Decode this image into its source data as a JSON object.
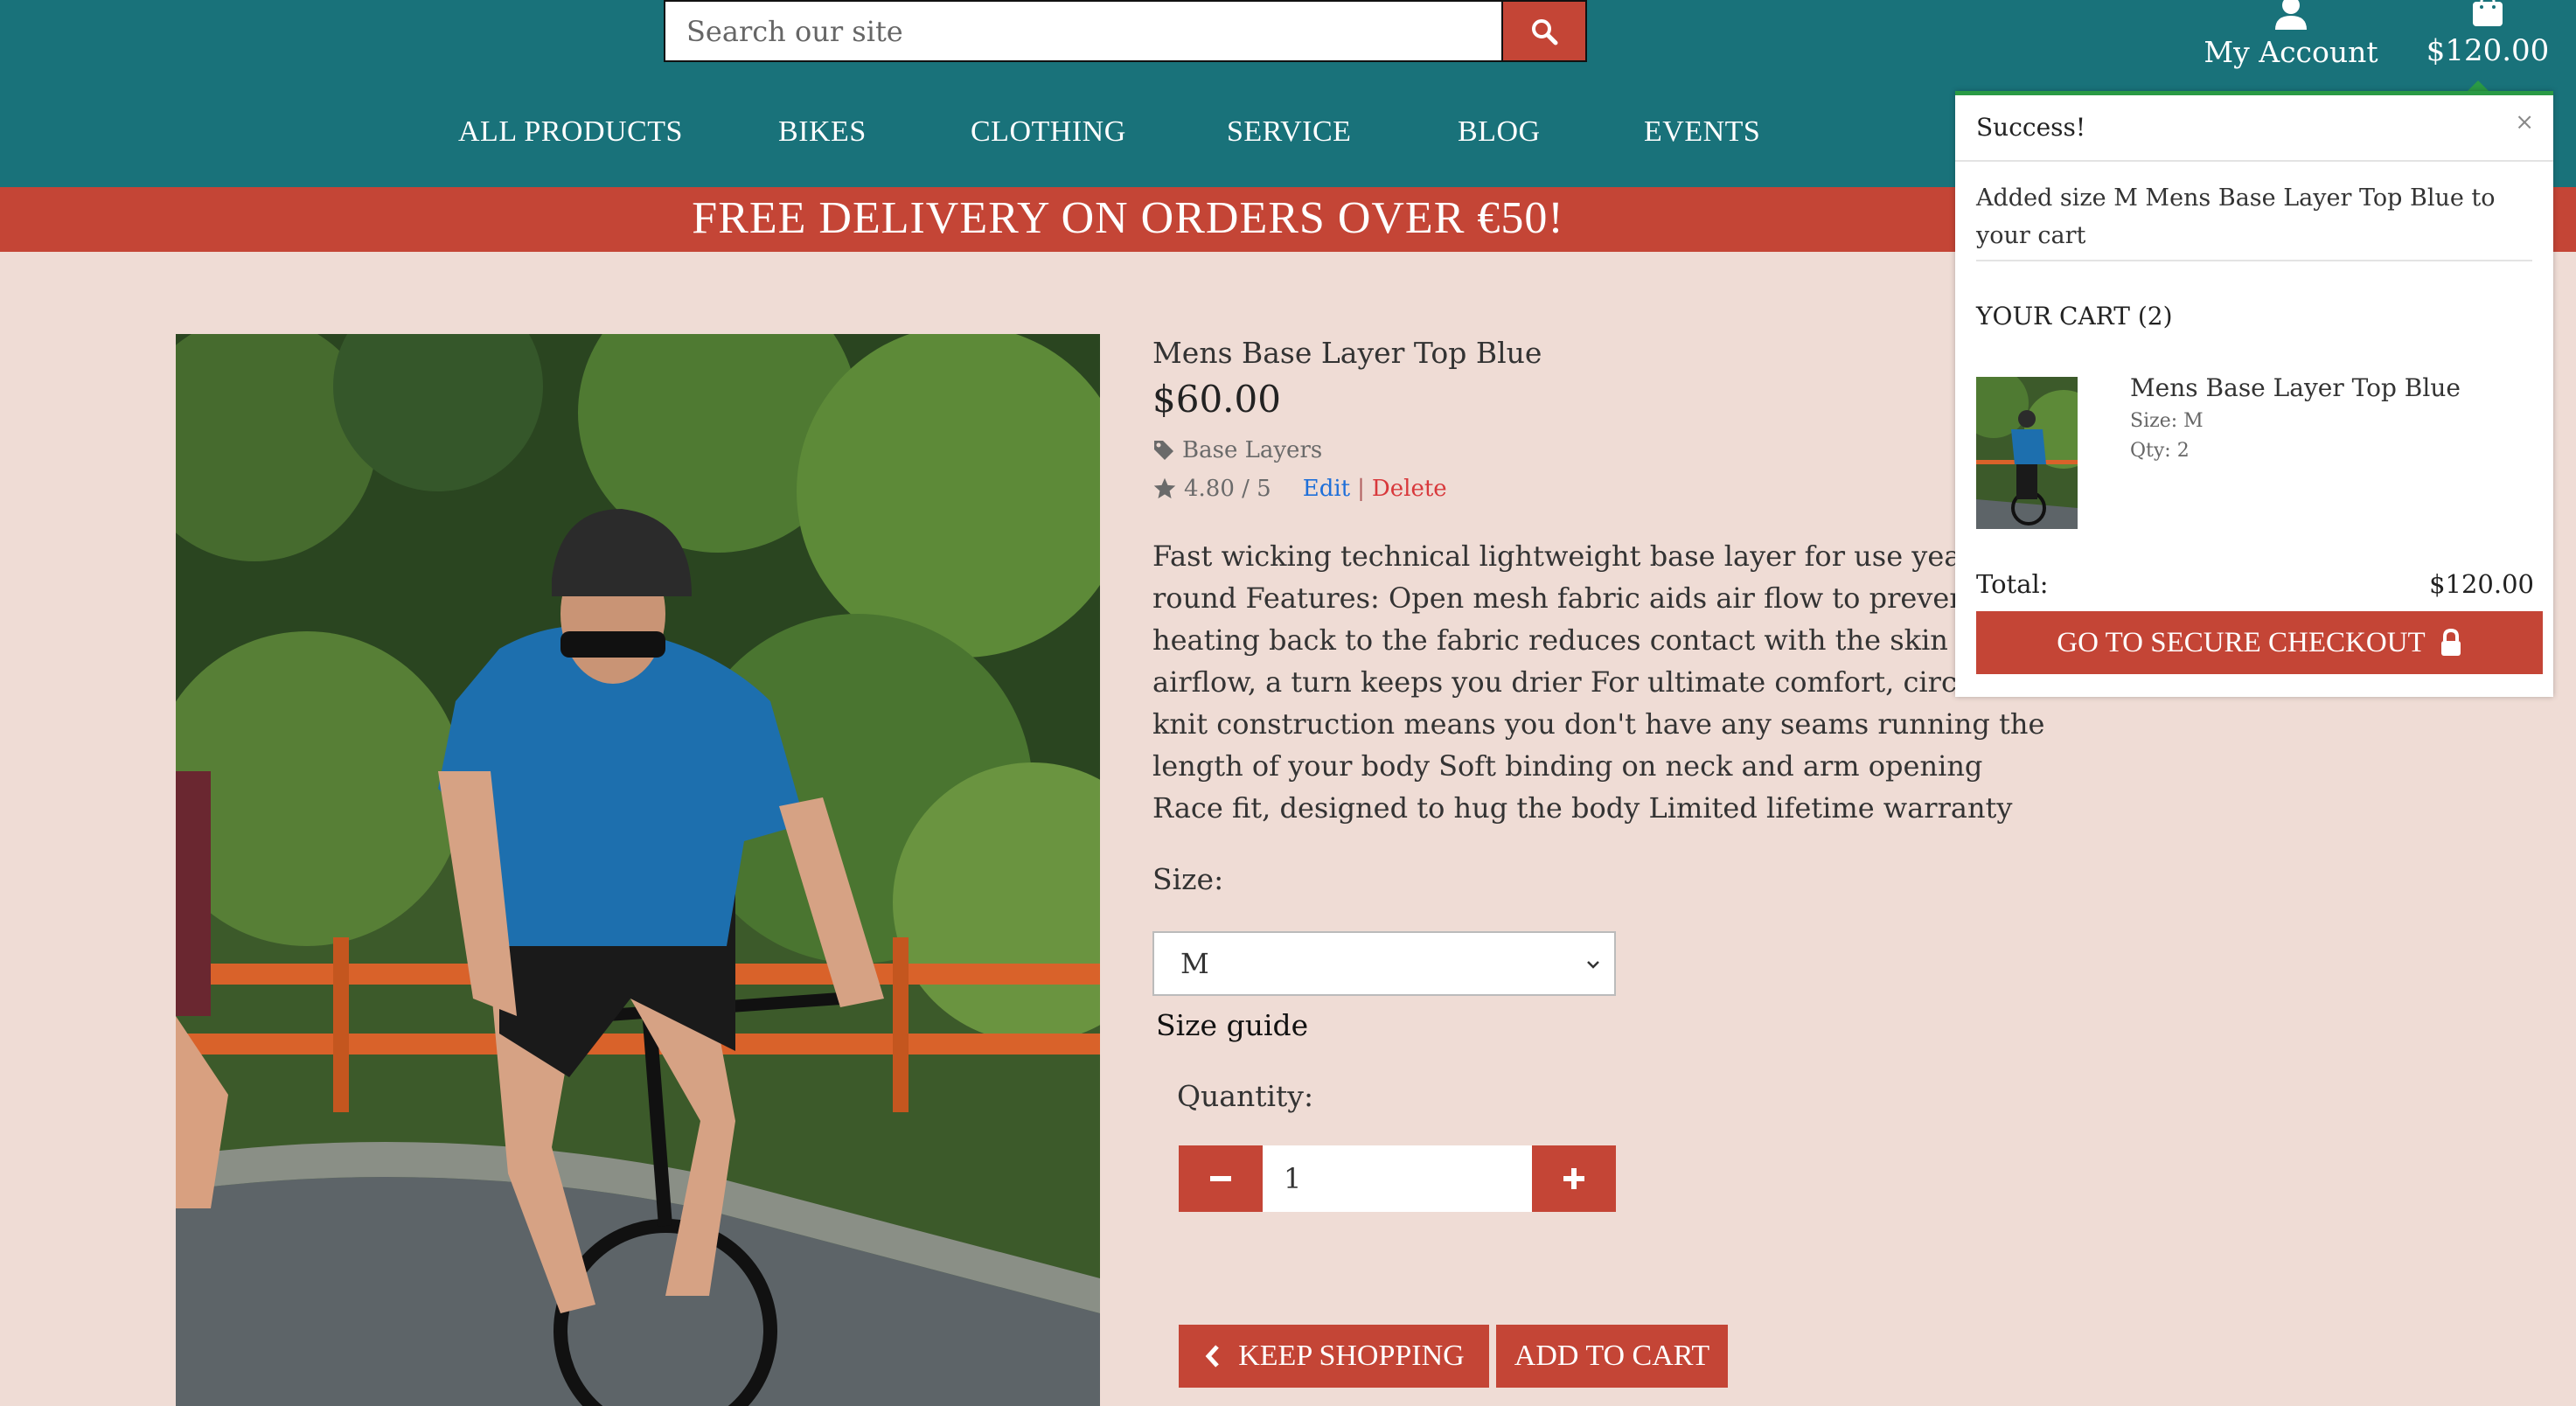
{
  "search": {
    "placeholder": "Search our site"
  },
  "header": {
    "account_label": "My Account",
    "cart_total": "$120.00"
  },
  "nav": {
    "items": [
      {
        "label": "ALL PRODUCTS"
      },
      {
        "label": "BIKES"
      },
      {
        "label": "CLOTHING"
      },
      {
        "label": "SERVICE"
      },
      {
        "label": "BLOG"
      },
      {
        "label": "EVENTS"
      }
    ]
  },
  "banner": {
    "text": "FREE DELIVERY ON ORDERS OVER €50!"
  },
  "product": {
    "name": "Mens Base Layer Top Blue",
    "price": "$60.00",
    "category": "Base Layers",
    "rating": "4.80 / 5",
    "edit_label": "Edit",
    "separator": "|",
    "delete_label": "Delete",
    "description": "Fast wicking technical lightweight base layer for use year round Features: Open mesh fabric aids air flow to prevent over heating back to the fabric reduces contact with the skin to aid airflow, a turn keeps you drier For ultimate comfort, circular knit construction means you don't have any seams running the length of your body Soft binding on neck and arm opening Race fit, designed to hug the body Limited lifetime warranty",
    "size_label": "Size:",
    "size_value": "M",
    "size_guide": "Size guide",
    "quantity_label": "Quantity:",
    "quantity_value": "1",
    "keep_shopping": "KEEP SHOPPING",
    "add_to_cart": "ADD TO CART"
  },
  "toast": {
    "title": "Success!",
    "close": "×",
    "message": "Added size M Mens Base Layer Top Blue to your cart",
    "cart_heading": "YOUR CART (2)",
    "item_name": "Mens Base Layer Top Blue",
    "item_size": "Size: M",
    "item_qty": "Qty: 2",
    "total_label": "Total:",
    "total_value": "$120.00",
    "checkout_label": "GO TO SECURE CHECKOUT"
  },
  "colors": {
    "header": "#19727a",
    "accent": "#c44536",
    "page_bg": "#efdcd5",
    "success": "#2a9a45"
  },
  "icons": [
    "search-icon",
    "user-icon",
    "shopping-bag-icon",
    "tag-icon",
    "star-icon",
    "chevron-down-icon",
    "minus-icon",
    "plus-icon",
    "chevron-left-icon",
    "lock-icon",
    "close-icon"
  ]
}
